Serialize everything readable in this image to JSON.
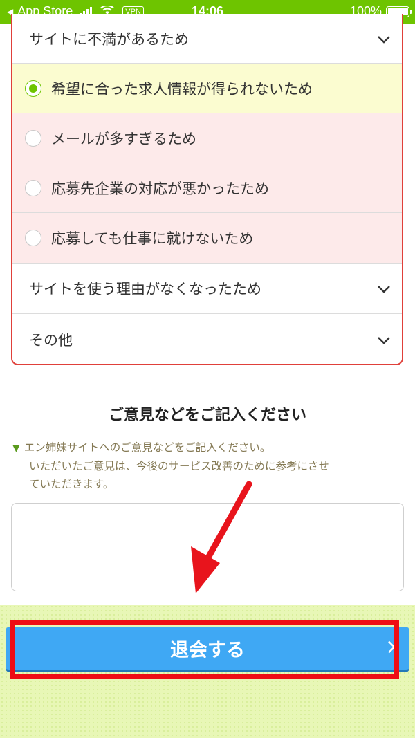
{
  "status_bar": {
    "back_label": "App Store",
    "vpn": "VPN",
    "time": "14:06",
    "battery": "100%"
  },
  "reasons": {
    "top_category": "サイトに不満があるため",
    "options": [
      {
        "label": "希望に合った求人情報が得られないため",
        "selected": true
      },
      {
        "label": "メールが多すぎるため",
        "selected": false
      },
      {
        "label": "応募先企業の対応が悪かったため",
        "selected": false
      },
      {
        "label": "応募しても仕事に就けないため",
        "selected": false
      }
    ],
    "categories": [
      "サイトを使う理由がなくなったため",
      "その他"
    ]
  },
  "opinion": {
    "title": "ご意見などをご記入ください",
    "note_line1": "エン姉妹サイトへのご意見などをご記入ください。",
    "note_line2": "いただいたご意見は、今後のサービス改善のために参考にさせ",
    "note_line3": "ていただきます。",
    "textarea_value": ""
  },
  "withdraw_button": {
    "label": "退会する"
  },
  "colors": {
    "status_bar": "#6ec400",
    "radio_selected": "#6ec400",
    "selected_row": "#fbfcd0",
    "option_row": "#fdeaea",
    "box_border": "#e0403a",
    "button": "#3fa8f4",
    "highlight": "#ee0d14",
    "bottom_bg": "#e8f7b6"
  }
}
